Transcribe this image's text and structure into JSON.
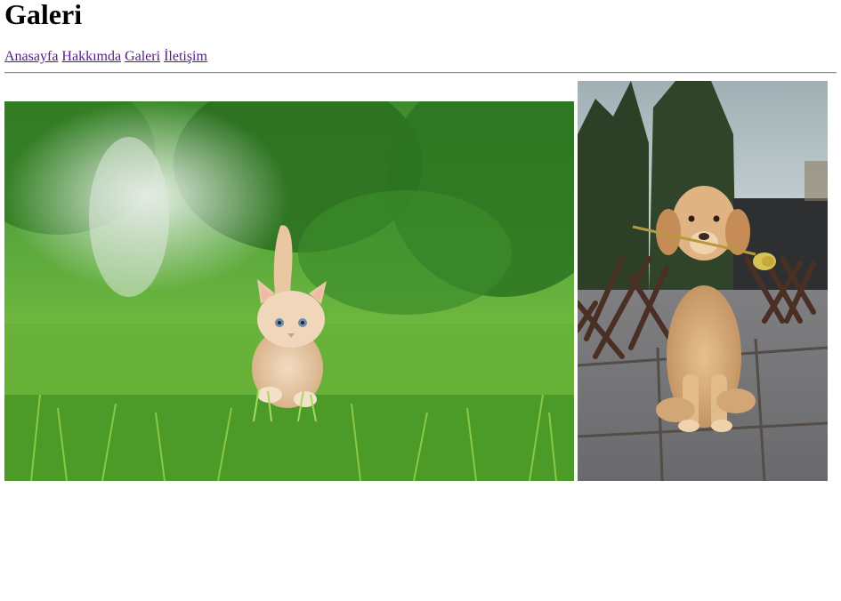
{
  "page": {
    "title": "Galeri"
  },
  "nav": {
    "links": [
      {
        "label": "Anasayfa"
      },
      {
        "label": "Hakkımda"
      },
      {
        "label": "Galeri"
      },
      {
        "label": "İletişim"
      }
    ]
  },
  "gallery": {
    "images": [
      {
        "subject": "kitten-in-grass"
      },
      {
        "subject": "puppy-with-flower"
      }
    ]
  },
  "colors": {
    "link_visited": "#551a8b",
    "divider": "#8e8e8e",
    "background": "#ffffff"
  }
}
